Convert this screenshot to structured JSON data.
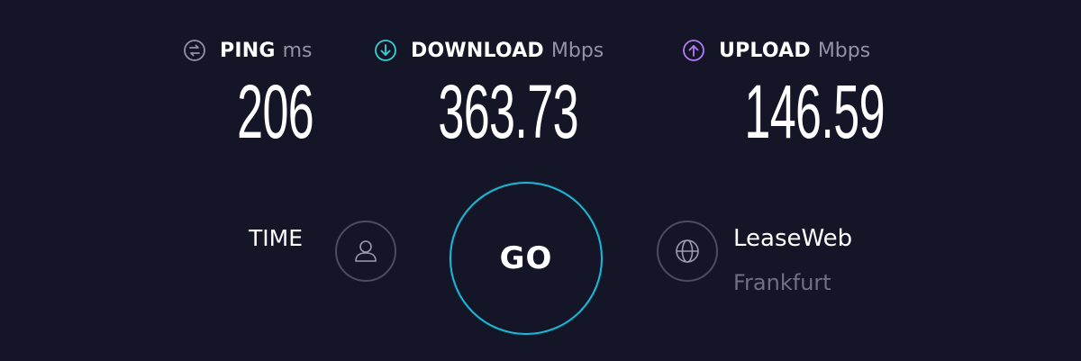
{
  "results": {
    "ping": {
      "label": "PING",
      "unit": "ms",
      "value": "206",
      "icon": "ping-icon",
      "icon_color": "#9193a8"
    },
    "download": {
      "label": "DOWNLOAD",
      "unit": "Mbps",
      "value": "363.73",
      "icon": "download-arrow-icon",
      "icon_color": "#34d3d8"
    },
    "upload": {
      "label": "UPLOAD",
      "unit": "Mbps",
      "value": "146.59",
      "icon": "upload-arrow-icon",
      "icon_color": "#b57ef6"
    }
  },
  "time": {
    "label": "TIME",
    "icon": "user-icon"
  },
  "go_button": {
    "label": "GO",
    "ring_color": "#1fb6d5"
  },
  "server": {
    "name": "LeaseWeb",
    "location": "Frankfurt",
    "icon": "globe-icon"
  },
  "colors": {
    "background": "#141526",
    "text_primary": "#ffffff",
    "text_muted": "#9193a8"
  }
}
